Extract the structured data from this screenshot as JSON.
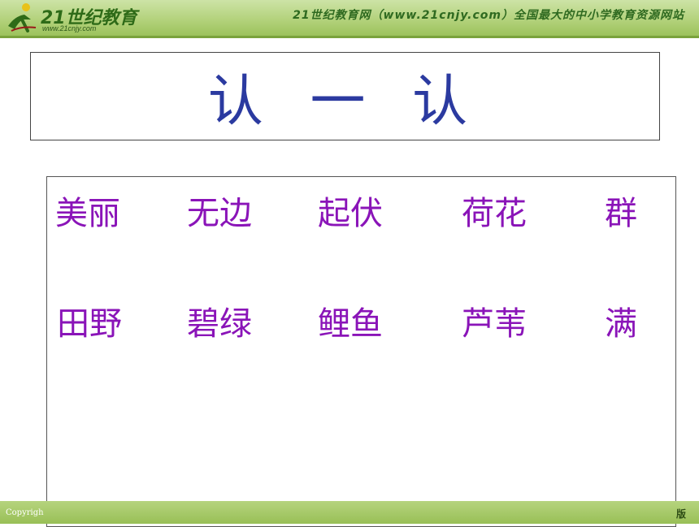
{
  "header": {
    "logo_text": "21世纪教育",
    "logo_url": "www.21cnjy.com",
    "tagline": "21世纪教育网（www.21cnjy.com）全国最大的中小学教育资源网站"
  },
  "title": "认 一 认",
  "words": {
    "row1": [
      "美丽",
      "无边",
      "起伏",
      "荷花",
      "群"
    ],
    "row2": [
      "田野",
      "碧绿",
      "鲤鱼",
      "芦苇",
      "满"
    ]
  },
  "footer": {
    "left_text": "Copyrigh",
    "right_text": "版"
  },
  "colors": {
    "title": "#2b3aa0",
    "words": "#8a14b8",
    "header_band": "#b3d27c"
  }
}
